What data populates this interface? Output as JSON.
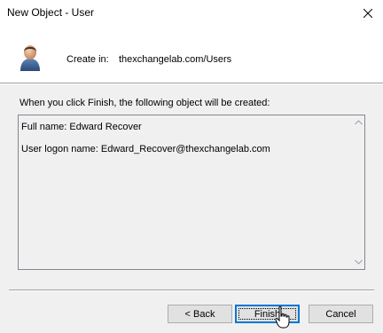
{
  "window": {
    "title": "New Object - User"
  },
  "header": {
    "create_in_label": "Create in:",
    "create_in_path": "thexchangelab.com/Users"
  },
  "body": {
    "info_text": "When you click Finish, the following object will be created:",
    "summary_lines": [
      "Full name: Edward Recover",
      "User logon name: Edward_Recover@thexchangelab.com"
    ]
  },
  "buttons": {
    "back": "< Back",
    "finish": "Finish",
    "cancel": "Cancel"
  },
  "icons": {
    "user": "user-icon",
    "close": "close-icon",
    "scroll_up": "scroll-up-arrow-icon",
    "scroll_down": "scroll-down-arrow-icon",
    "cursor": "hand-pointer-cursor-icon"
  },
  "colors": {
    "dialog_bg": "#f0f0f0",
    "panel_bg": "#ffffff",
    "default_button_border": "#0078d7"
  }
}
